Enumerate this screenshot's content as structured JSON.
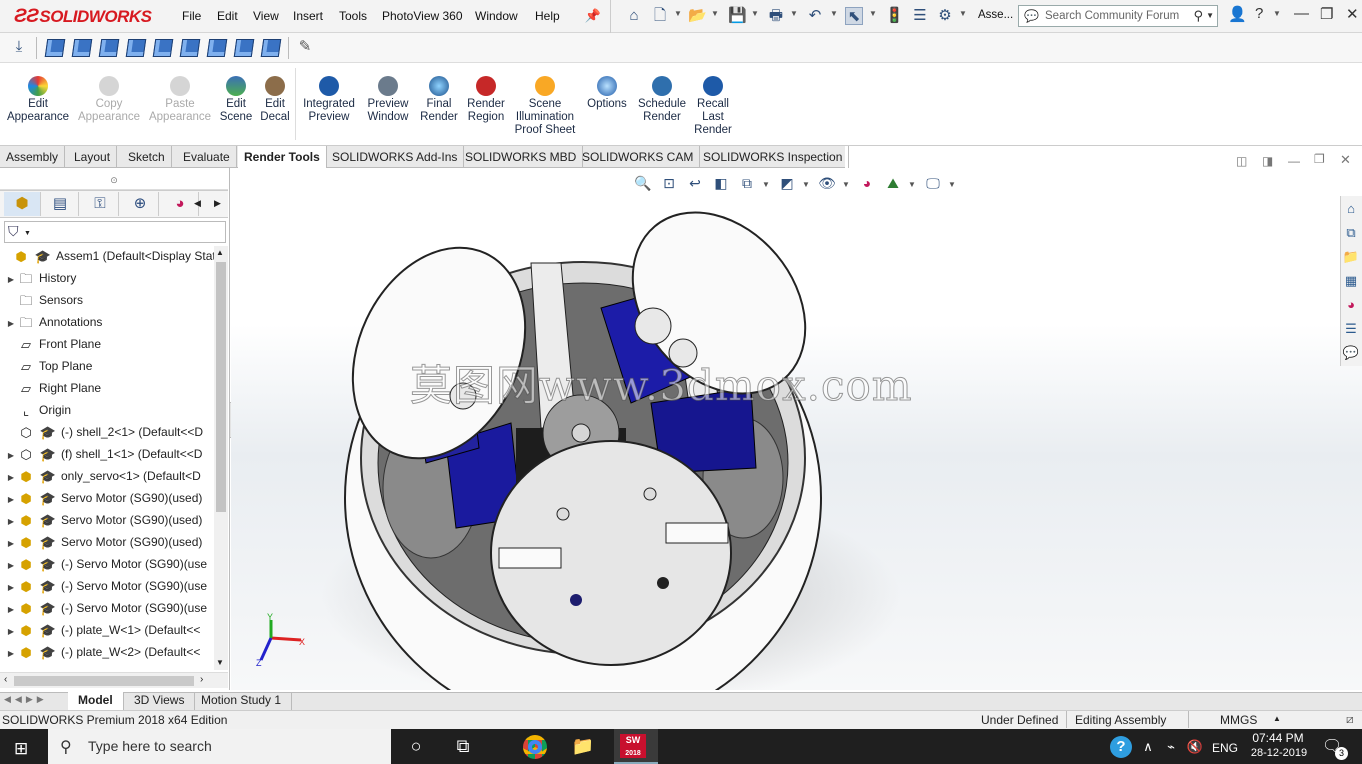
{
  "app": {
    "logo_text": "SOLIDWORKS",
    "menu": [
      "File",
      "Edit",
      "View",
      "Insert",
      "Tools",
      "PhotoView 360",
      "Window",
      "Help"
    ],
    "doc_name_short": "Asse...",
    "search_placeholder": "Search Community Forum"
  },
  "ribbon": {
    "buttons": [
      {
        "label": "Edit\nAppearance",
        "enabled": true,
        "icon": "appearance-icon"
      },
      {
        "label": "Copy\nAppearance",
        "enabled": false,
        "icon": "copy-appearance-icon"
      },
      {
        "label": "Paste\nAppearance",
        "enabled": false,
        "icon": "paste-appearance-icon"
      },
      {
        "label": "Edit\nScene",
        "enabled": true,
        "icon": "scene-icon"
      },
      {
        "label": "Edit\nDecal",
        "enabled": true,
        "icon": "decal-icon"
      },
      {
        "label": "Integrated\nPreview",
        "enabled": true,
        "icon": "integrated-preview-icon"
      },
      {
        "label": "Preview\nWindow",
        "enabled": true,
        "icon": "preview-window-icon"
      },
      {
        "label": "Final\nRender",
        "enabled": true,
        "icon": "final-render-icon"
      },
      {
        "label": "Render\nRegion",
        "enabled": true,
        "icon": "render-region-icon"
      },
      {
        "label": "Scene\nIllumination\nProof Sheet",
        "enabled": true,
        "icon": "illumination-icon"
      },
      {
        "label": "Options",
        "enabled": true,
        "icon": "options-icon"
      },
      {
        "label": "Schedule\nRender",
        "enabled": true,
        "icon": "schedule-icon"
      },
      {
        "label": "Recall\nLast\nRender",
        "enabled": true,
        "icon": "recall-icon"
      }
    ]
  },
  "command_tabs": [
    "Assembly",
    "Layout",
    "Sketch",
    "Evaluate",
    "Render Tools",
    "SOLIDWORKS Add-Ins",
    "SOLIDWORKS MBD",
    "SOLIDWORKS CAM",
    "SOLIDWORKS Inspection"
  ],
  "active_command_tab": "Render Tools",
  "feature_tree": {
    "items": [
      {
        "label": "Assem1  (Default<Display State",
        "kind": "root"
      },
      {
        "label": "History",
        "kind": "folder",
        "expandable": true
      },
      {
        "label": "Sensors",
        "kind": "folder",
        "expandable": false
      },
      {
        "label": "Annotations",
        "kind": "folder",
        "expandable": true
      },
      {
        "label": "Front Plane",
        "kind": "plane",
        "expandable": false
      },
      {
        "label": "Top Plane",
        "kind": "plane",
        "expandable": false
      },
      {
        "label": "Right Plane",
        "kind": "plane",
        "expandable": false
      },
      {
        "label": "Origin",
        "kind": "origin",
        "expandable": false
      },
      {
        "label": "(-) shell_2<1> (Default<<D",
        "kind": "part",
        "expandable": false
      },
      {
        "label": "(f) shell_1<1> (Default<<D",
        "kind": "part",
        "expandable": true
      },
      {
        "label": "only_servo<1> (Default<D",
        "kind": "asm",
        "expandable": true
      },
      {
        "label": "Servo Motor (SG90)(used)",
        "kind": "asm",
        "expandable": true
      },
      {
        "label": "Servo Motor (SG90)(used)",
        "kind": "asm",
        "expandable": true
      },
      {
        "label": "Servo Motor (SG90)(used)",
        "kind": "asm",
        "expandable": true
      },
      {
        "label": "(-) Servo Motor (SG90)(use",
        "kind": "asm",
        "expandable": true
      },
      {
        "label": "(-) Servo Motor (SG90)(use",
        "kind": "asm",
        "expandable": true
      },
      {
        "label": "(-) Servo Motor (SG90)(use",
        "kind": "asm",
        "expandable": true
      },
      {
        "label": "(-) plate_W<1> (Default<<",
        "kind": "asm",
        "expandable": true
      },
      {
        "label": "(-) plate_W<2> (Default<<",
        "kind": "asm",
        "expandable": true
      }
    ]
  },
  "bottom_tabs": [
    "Model",
    "3D Views",
    "Motion Study 1"
  ],
  "active_bottom_tab": "Model",
  "status": {
    "edition": "SOLIDWORKS Premium 2018 x64 Edition",
    "definition": "Under Defined",
    "mode": "Editing Assembly",
    "units": "MMGS"
  },
  "watermark": "莫图网www.3dmox.com",
  "triad": {
    "x": "X",
    "y": "Y",
    "z": "Z"
  },
  "taskbar": {
    "search_placeholder": "Type here to search",
    "language": "ENG",
    "time": "07:44 PM",
    "date": "28-12-2019",
    "notifications": "3",
    "sw_badge": "2018"
  }
}
